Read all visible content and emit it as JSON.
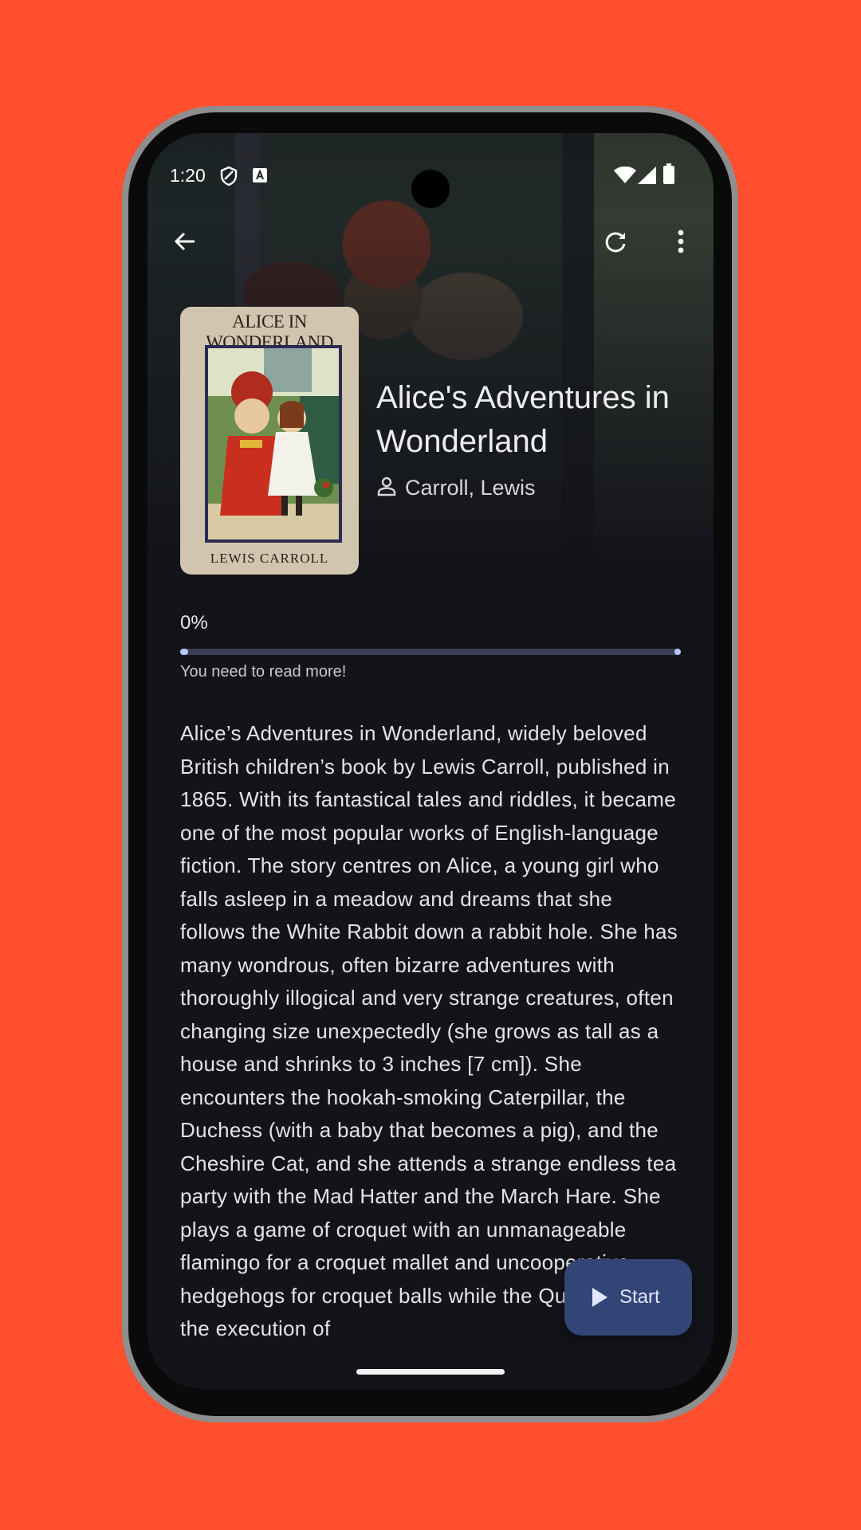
{
  "status_bar": {
    "time": "1:20",
    "left_icons": [
      "shield-icon",
      "accessibility-icon"
    ],
    "right_icons": [
      "wifi-icon",
      "signal-icon",
      "battery-icon"
    ]
  },
  "app_bar": {
    "back_icon": "arrow-back-icon",
    "refresh_icon": "refresh-icon",
    "menu_icon": "more-vert-icon"
  },
  "book": {
    "cover_title": "ALICE IN WONDERLAND",
    "cover_author": "LEWIS CARROLL",
    "title": "Alice's Adventures in Wonderland",
    "author": "Carroll, Lewis"
  },
  "progress": {
    "value": 0,
    "label": "0%",
    "hint": "You need to read more!"
  },
  "description": "Alice’s Adventures in Wonderland, widely beloved British children’s book by Lewis Carroll, published in 1865. With its fantastical tales and riddles, it became one of the most popular works of English-language fiction. The story centres on Alice, a young girl who falls asleep in a meadow and dreams that she follows the White Rabbit down a rabbit hole. She has many wondrous, often bizarre adventures with thoroughly illogical and very strange creatures, often changing size unexpectedly (she grows as tall as a house and shrinks to 3 inches [7 cm]). She encounters the hookah-smoking Caterpillar, the Duchess (with a baby that becomes a pig), and the Cheshire Cat, and she attends a strange endless tea party with the Mad Hatter and the March Hare. She plays a game of croquet with an unmanageable flamingo for a croquet mallet and uncooperative hedgehogs for croquet balls while the Queen calls for the execution of",
  "fab": {
    "label": "Start",
    "icon": "play-icon"
  },
  "colors": {
    "background": "#FF4F2E",
    "screen": "#13141A",
    "accent": "#B6C4FF",
    "fab": "#334477"
  }
}
